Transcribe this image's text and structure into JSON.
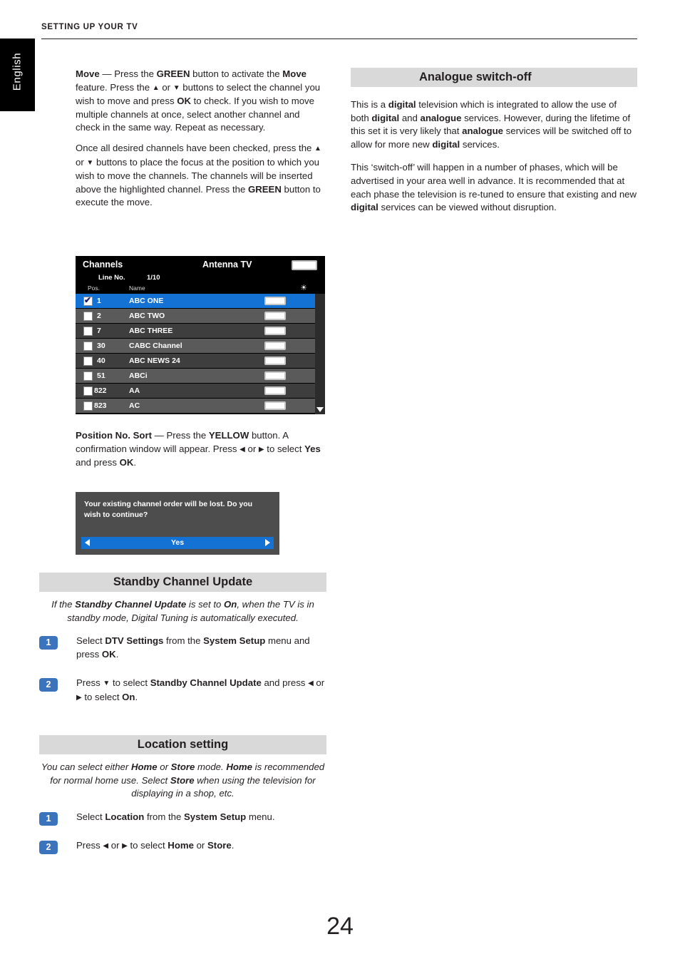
{
  "header": {
    "title": "SETTING UP YOUR TV"
  },
  "side_tab": {
    "label": "English"
  },
  "left_column": {
    "move_paragraph_1_prefix": "Move",
    "move_paragraph_1": " — Press the GREEN button to activate the Move feature. Press the ▲ or ▼ buttons to select the channel you wish to move and press OK to check. If you wish to move multiple channels at once, select another channel and check in the same way. Repeat as necessary.",
    "move_paragraph_2": "Once all desired channels have been checked, press the ▲ or ▼ buttons to place the focus at the position to which you wish to move the channels. The channels will be inserted above the highlighted channel. Press the GREEN button to execute the move.",
    "position_sort_label": "Position No. Sort",
    "position_sort_text": " — Press the YELLOW button. A confirmation window will appear. Press ◀ or ▶ to select Yes and press OK."
  },
  "channel_screen": {
    "title": "Channels",
    "source": "Antenna TV",
    "line_no_label": "Line No.",
    "line_no_value": "1/10",
    "col_pos": "Pos.",
    "col_name": "Name",
    "rows": [
      {
        "checked": true,
        "pos": "1",
        "name": "ABC ONE",
        "selected": true
      },
      {
        "checked": false,
        "pos": "2",
        "name": "ABC TWO",
        "selected": false
      },
      {
        "checked": false,
        "pos": "7",
        "name": "ABC THREE",
        "selected": false
      },
      {
        "checked": false,
        "pos": "30",
        "name": "CABC Channel",
        "selected": false
      },
      {
        "checked": false,
        "pos": "40",
        "name": "ABC NEWS 24",
        "selected": false
      },
      {
        "checked": false,
        "pos": "51",
        "name": "ABCi",
        "selected": false
      },
      {
        "checked": false,
        "pos": "822",
        "name": "AA",
        "selected": false
      },
      {
        "checked": false,
        "pos": "823",
        "name": "AC",
        "selected": false
      }
    ]
  },
  "confirm_dialog": {
    "message": "Your existing channel order will be lost. Do you wish to continue?",
    "yes_label": "Yes"
  },
  "standby_section": {
    "title": "Standby Channel Update",
    "note": "If the Standby Channel Update is set to On, when the TV is in standby mode, Digital Tuning is automatically executed.",
    "steps": [
      {
        "num": "1",
        "text": "Select DTV Settings from the System Setup menu and press OK."
      },
      {
        "num": "2",
        "text": "Press ▼ to select Standby Channel Update and press ◀ or ▶ to select On."
      }
    ]
  },
  "location_section": {
    "title": "Location setting",
    "note": "You can select either Home or Store mode. Home is recommended for normal home use. Select Store when using the television for displaying in a shop, etc.",
    "steps": [
      {
        "num": "1",
        "text": "Select Location from the System Setup menu."
      },
      {
        "num": "2",
        "text": "Press ◀ or ▶ to select Home or Store."
      }
    ]
  },
  "right_column": {
    "title_bold": "Analogue",
    "title_rest": " switch-off",
    "paragraph_1": "This is a digital television which is integrated to allow the use of both digital and analogue services. However, during the lifetime of this set it is very likely that analogue services will be switched off to allow for more new digital services.",
    "paragraph_2": "This ‘switch-off’ will happen in a number of phases, which will be advertised in your area well in advance. It is recommended that at each phase the television is re-tuned to ensure that existing and new digital services can be viewed without disruption."
  },
  "page_number": "24"
}
